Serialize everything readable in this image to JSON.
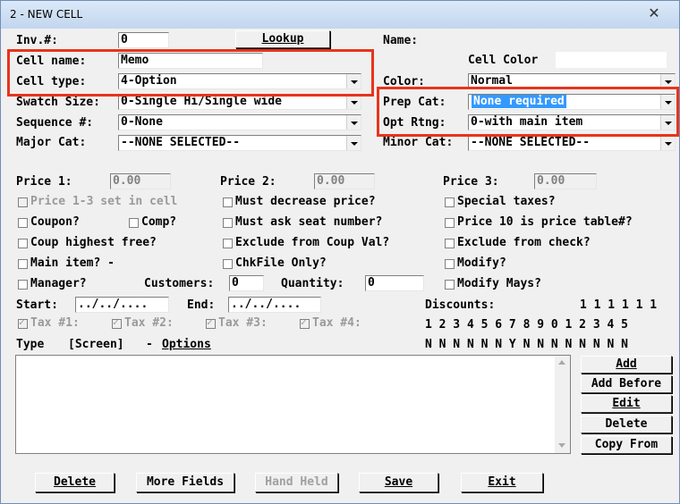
{
  "window": {
    "title": "2 - NEW CELL",
    "close": "✕"
  },
  "form": {
    "inv_label": "Inv.#:",
    "inv_value": "0",
    "lookup_button": "Lookup",
    "name_label": "Name:",
    "cell_name_label": "Cell name:",
    "cell_name_value": "Memo",
    "cell_color_label": "Cell Color",
    "cell_color_value": "",
    "cell_type_label": "Cell type:",
    "cell_type_value": "4-Option",
    "color_label": "Color:",
    "color_value": "Normal",
    "swatch_label": "Swatch Size:",
    "swatch_value": "0-Single Hi/Single wide",
    "prep_label": "Prep Cat:",
    "prep_value": "None required",
    "sequence_label": "Sequence #:",
    "sequence_value": "0-None",
    "opt_label": "Opt Rtng:",
    "opt_value": "0-with main item",
    "major_label": "Major Cat:",
    "major_value": "--NONE SELECTED--",
    "minor_label": "Minor Cat:",
    "minor_value": "--NONE SELECTED--"
  },
  "prices": {
    "p1_label": "Price 1:",
    "p1_value": "0.00",
    "p2_label": "Price 2:",
    "p2_value": "0.00",
    "p3_label": "Price 3:",
    "p3_value": "0.00"
  },
  "checks": {
    "price13": "Price 1-3 set in cell",
    "must_decrease": "Must decrease price?",
    "special_taxes": "Special taxes?",
    "coupon": "Coupon?",
    "comp": "Comp?",
    "must_seat": "Must ask seat number?",
    "price10": "Price 10 is price table#?",
    "coup_highest": "Coup highest free?",
    "exclude_coup": "Exclude from Coup Val?",
    "exclude_check": "Exclude from check?",
    "main_item": "Main item? -",
    "chkfile": "ChkFile Only?",
    "modify": "Modify?",
    "manager": "Manager?",
    "customers_label": "Customers:",
    "customers_value": "0",
    "quantity_label": "Quantity:",
    "quantity_value": "0",
    "modify_mays": "Modify Mays?",
    "start_label": "Start:",
    "start_value": "../../....",
    "end_label": "End:",
    "end_value": "../../....",
    "tax1": "Tax #1:",
    "tax2": "Tax #2:",
    "tax3": "Tax #3:",
    "tax4": "Tax #4:"
  },
  "discounts": {
    "label": "Discounts:",
    "tens": "1 1 1 1 1 1",
    "ones": "1 2 3 4 5 6 7 8 9 0 1 2 3 4 5",
    "flags": "N N N N N N Y N N N N N N N N"
  },
  "list": {
    "type_label": "Type",
    "screen_label": "[Screen]",
    "dash": "-",
    "options_label": "Options"
  },
  "side_buttons": {
    "add": "Add",
    "add_before": "Add Before",
    "edit": "Edit",
    "delete": "Delete",
    "copy_from": "Copy From"
  },
  "bottom_buttons": {
    "delete": "Delete",
    "more_fields": "More Fields",
    "hand_held": "Hand Held",
    "save": "Save",
    "exit": "Exit"
  }
}
